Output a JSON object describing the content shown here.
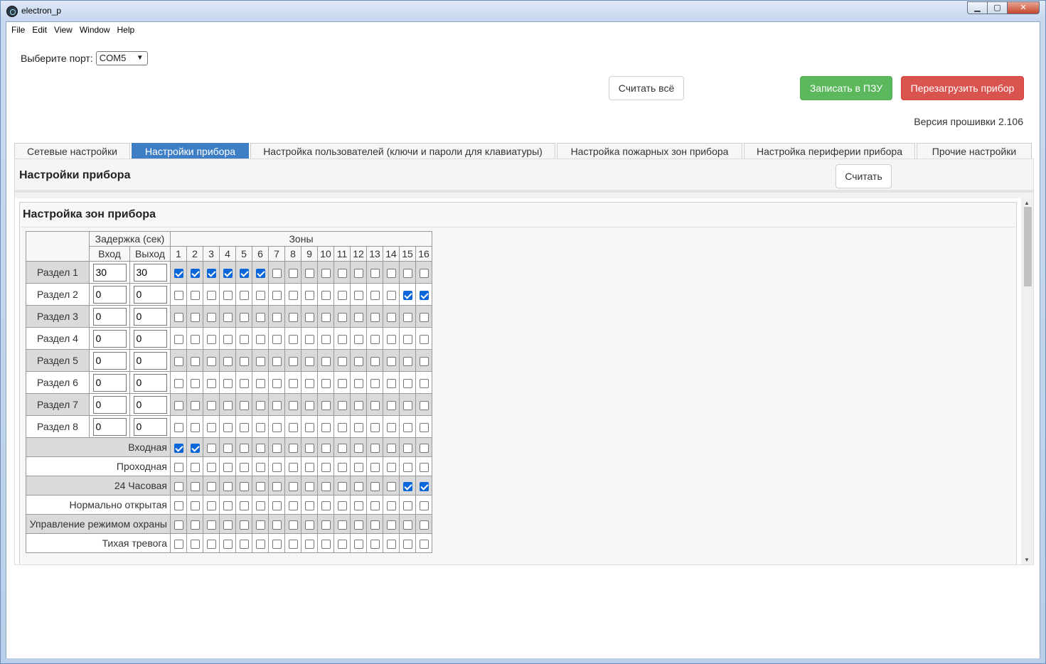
{
  "window": {
    "title": "electron_p",
    "controls": {
      "minimize": "▁",
      "maximize": "▢",
      "close": "✕"
    }
  },
  "menu": [
    "File",
    "Edit",
    "View",
    "Window",
    "Help"
  ],
  "port": {
    "label": "Выберите порт:",
    "value": "COM5"
  },
  "buttons": {
    "read_all": "Считать всё",
    "write": "Записать в ПЗУ",
    "reboot": "Перезагрузить прибор",
    "read": "Считать"
  },
  "firmware": "Версия прошивки 2.106",
  "tabs": [
    "Сетевые настройки",
    "Настройки прибора",
    "Настройка пользователей (ключи и пароли для клавиатуры)",
    "Настройка пожарных зон прибора",
    "Настройка периферии прибора",
    "Прочие настройки"
  ],
  "active_tab": 1,
  "panel_title": "Настройки прибора",
  "section_title": "Настройка зон прибора",
  "table": {
    "delay_header": "Задержка (сек)",
    "zones_header": "Зоны",
    "entry": "Вход",
    "exit": "Выход",
    "zones": [
      "1",
      "2",
      "3",
      "4",
      "5",
      "6",
      "7",
      "8",
      "9",
      "10",
      "11",
      "12",
      "13",
      "14",
      "15",
      "16"
    ],
    "sections": [
      {
        "name": "Раздел 1",
        "entry": "30",
        "exit": "30",
        "zones": [
          1,
          1,
          1,
          1,
          1,
          1,
          0,
          0,
          0,
          0,
          0,
          0,
          0,
          0,
          0,
          0
        ]
      },
      {
        "name": "Раздел 2",
        "entry": "0",
        "exit": "0",
        "zones": [
          0,
          0,
          0,
          0,
          0,
          0,
          0,
          0,
          0,
          0,
          0,
          0,
          0,
          0,
          1,
          1
        ]
      },
      {
        "name": "Раздел 3",
        "entry": "0",
        "exit": "0",
        "zones": [
          0,
          0,
          0,
          0,
          0,
          0,
          0,
          0,
          0,
          0,
          0,
          0,
          0,
          0,
          0,
          0
        ]
      },
      {
        "name": "Раздел 4",
        "entry": "0",
        "exit": "0",
        "zones": [
          0,
          0,
          0,
          0,
          0,
          0,
          0,
          0,
          0,
          0,
          0,
          0,
          0,
          0,
          0,
          0
        ]
      },
      {
        "name": "Раздел 5",
        "entry": "0",
        "exit": "0",
        "zones": [
          0,
          0,
          0,
          0,
          0,
          0,
          0,
          0,
          0,
          0,
          0,
          0,
          0,
          0,
          0,
          0
        ]
      },
      {
        "name": "Раздел 6",
        "entry": "0",
        "exit": "0",
        "zones": [
          0,
          0,
          0,
          0,
          0,
          0,
          0,
          0,
          0,
          0,
          0,
          0,
          0,
          0,
          0,
          0
        ]
      },
      {
        "name": "Раздел 7",
        "entry": "0",
        "exit": "0",
        "zones": [
          0,
          0,
          0,
          0,
          0,
          0,
          0,
          0,
          0,
          0,
          0,
          0,
          0,
          0,
          0,
          0
        ]
      },
      {
        "name": "Раздел 8",
        "entry": "0",
        "exit": "0",
        "zones": [
          0,
          0,
          0,
          0,
          0,
          0,
          0,
          0,
          0,
          0,
          0,
          0,
          0,
          0,
          0,
          0
        ]
      }
    ],
    "types": [
      {
        "name": "Входная",
        "zones": [
          1,
          1,
          0,
          0,
          0,
          0,
          0,
          0,
          0,
          0,
          0,
          0,
          0,
          0,
          0,
          0
        ]
      },
      {
        "name": "Проходная",
        "zones": [
          0,
          0,
          0,
          0,
          0,
          0,
          0,
          0,
          0,
          0,
          0,
          0,
          0,
          0,
          0,
          0
        ]
      },
      {
        "name": "24 Часовая",
        "zones": [
          0,
          0,
          0,
          0,
          0,
          0,
          0,
          0,
          0,
          0,
          0,
          0,
          0,
          0,
          1,
          1
        ]
      },
      {
        "name": "Нормально открытая",
        "zones": [
          0,
          0,
          0,
          0,
          0,
          0,
          0,
          0,
          0,
          0,
          0,
          0,
          0,
          0,
          0,
          0
        ]
      },
      {
        "name": "Управление режимом охраны",
        "zones": [
          0,
          0,
          0,
          0,
          0,
          0,
          0,
          0,
          0,
          0,
          0,
          0,
          0,
          0,
          0,
          0
        ]
      },
      {
        "name": "Тихая тревога",
        "zones": [
          0,
          0,
          0,
          0,
          0,
          0,
          0,
          0,
          0,
          0,
          0,
          0,
          0,
          0,
          0,
          0
        ]
      }
    ]
  }
}
